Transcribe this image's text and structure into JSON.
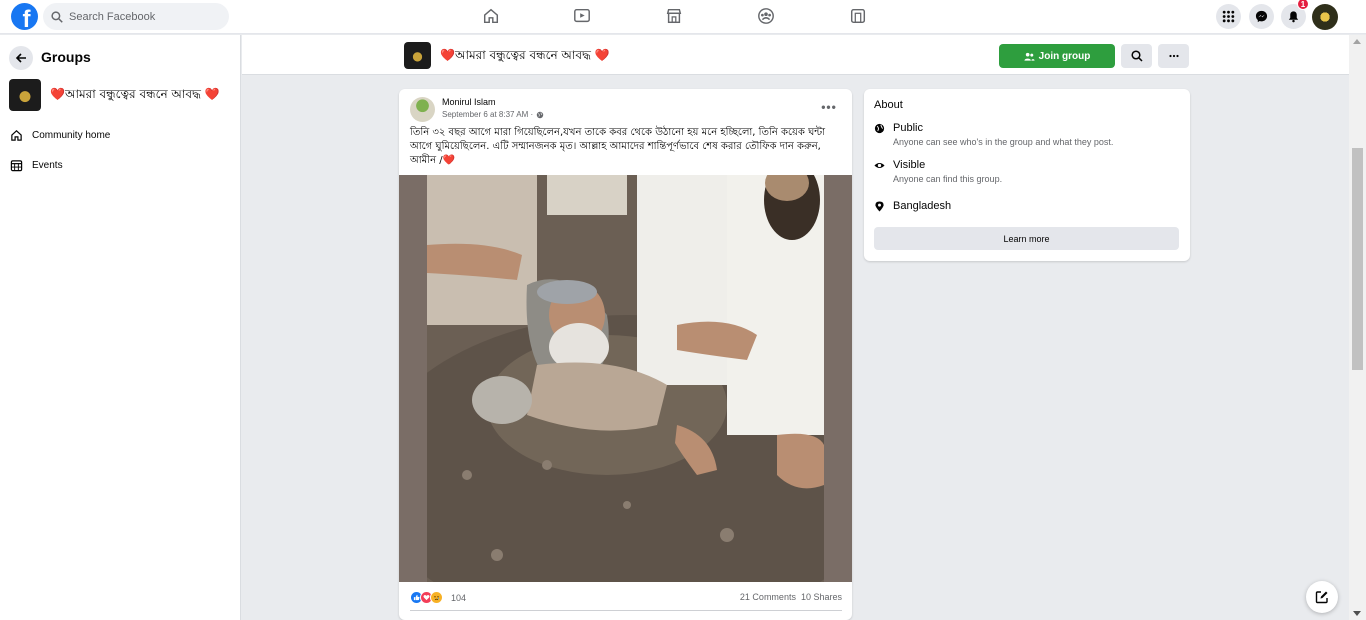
{
  "topbar": {
    "logo": "facebook-logo",
    "logo_letter": "f",
    "search_placeholder": "Search Facebook",
    "nav_icons": [
      "home-icon",
      "watch-icon",
      "marketplace-icon",
      "groups-icon",
      "gaming-icon"
    ],
    "right_icons": [
      "menu-grid-icon",
      "messenger-icon",
      "notifications-icon"
    ],
    "notification_count": "1"
  },
  "sidebar": {
    "title": "Groups",
    "group_name": "❤️আমরা বন্ধুত্বের বন্ধনে আবদ্ধ ❤️",
    "links": [
      {
        "label": "Community home",
        "icon": "home-icon"
      },
      {
        "label": "Events",
        "icon": "calendar-icon"
      }
    ]
  },
  "group_header": {
    "name": "❤️আমরা বন্ধুত্বের বন্ধনে আবদ্ধ ❤️",
    "join_label": "Join group",
    "accent": "#2e9e3e"
  },
  "post": {
    "author": "Monirul Islam",
    "timestamp": "September 6 at 8:37 AM ·",
    "text": "তিনি ৩২ বছর আগে মারা গিয়েছিলেন,যখন তাকে কবর থেকে উঠানো হয় মনে হচ্ছিলো, তিনি কয়েক ঘন্টা আগে ঘুমিয়েছিলেন. এটি সম্মানজনক মৃত। আল্লাহ আমাদের শান্তিপূর্ণভাবে শেষ করার তৌফিক দান করুন, আমীন /❤️",
    "reaction_count": "104",
    "comments": "21 Comments",
    "shares": "10 Shares"
  },
  "about": {
    "title": "About",
    "items": [
      {
        "title": "Public",
        "desc": "Anyone can see who's in the group and what they post.",
        "icon": "globe-icon"
      },
      {
        "title": "Visible",
        "desc": "Anyone can find this group.",
        "icon": "eye-icon"
      },
      {
        "title": "Bangladesh",
        "desc": "",
        "icon": "location-pin-icon"
      }
    ],
    "learn_more": "Learn more"
  }
}
